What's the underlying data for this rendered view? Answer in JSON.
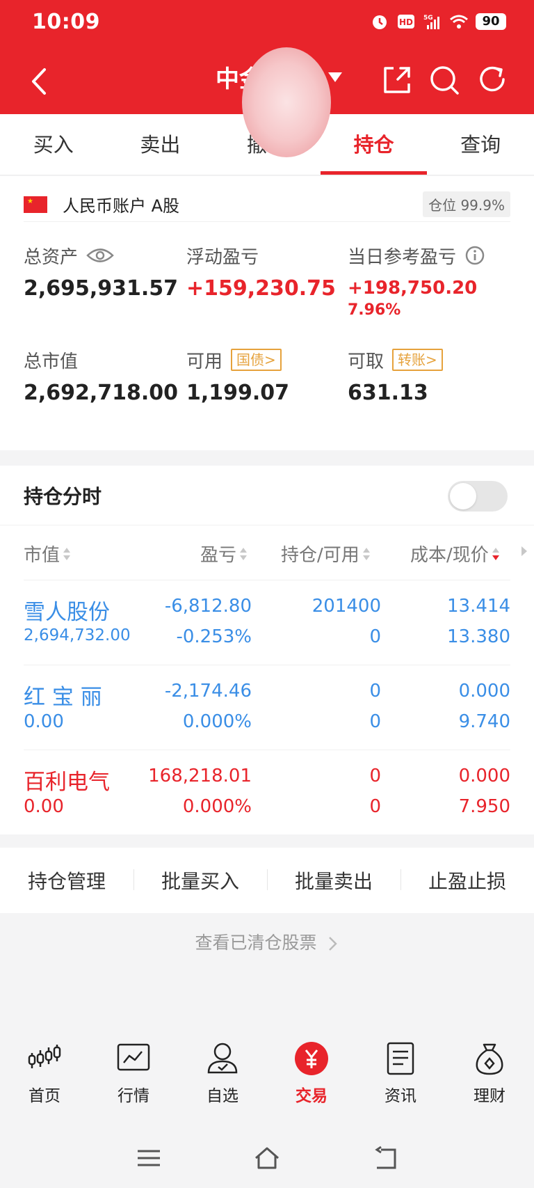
{
  "status_bar": {
    "time": "10:09",
    "battery": "90"
  },
  "header": {
    "title": "中金",
    "colors": {
      "brand": "#e8242b",
      "profit": "#e8242b",
      "loss_blue": "#3a8ee6",
      "tag_orange": "#e6a23c"
    }
  },
  "tabs": [
    {
      "label": "买入"
    },
    {
      "label": "卖出"
    },
    {
      "label": "撤单"
    },
    {
      "label": "持仓",
      "active": true
    },
    {
      "label": "查询"
    }
  ],
  "account": {
    "name": "人民币账户 A股",
    "position_label": "仓位 99.9%",
    "total_assets": {
      "label": "总资产",
      "value": "2,695,931.57"
    },
    "floating_pnl": {
      "label": "浮动盈亏",
      "value": "+159,230.75"
    },
    "daily_pnl": {
      "label": "当日参考盈亏",
      "value": "+198,750.20",
      "pct": "7.96%"
    },
    "market_value": {
      "label": "总市值",
      "value": "2,692,718.00"
    },
    "available": {
      "label": "可用",
      "tag": "国债>",
      "value": "1,199.07"
    },
    "withdrawable": {
      "label": "可取",
      "tag": "转账>",
      "value": "631.13"
    }
  },
  "holdings": {
    "title": "持仓分时",
    "toggle_on": false,
    "columns": [
      "市值",
      "盈亏",
      "持仓/可用",
      "成本/现价"
    ],
    "rows": [
      {
        "name": "雪人股份",
        "market_value": "2,694,732.00",
        "pnl": "-6,812.80",
        "pnl_pct": "-0.253%",
        "position": "201400",
        "available": "0",
        "cost": "13.414",
        "price": "13.380",
        "color": "blue"
      },
      {
        "name": "红 宝 丽",
        "market_value": "0.00",
        "pnl": "-2,174.46",
        "pnl_pct": "0.000%",
        "position": "0",
        "available": "0",
        "cost": "0.000",
        "price": "9.740",
        "color": "blue"
      },
      {
        "name": "百利电气",
        "market_value": "0.00",
        "pnl": "168,218.01",
        "pnl_pct": "0.000%",
        "position": "0",
        "available": "0",
        "cost": "0.000",
        "price": "7.950",
        "color": "red"
      }
    ]
  },
  "actions": [
    "持仓管理",
    "批量买入",
    "批量卖出",
    "止盈止损"
  ],
  "cleared_link": "查看已清仓股票",
  "bottom_nav": [
    {
      "label": "首页",
      "icon": "candlestick-icon"
    },
    {
      "label": "行情",
      "icon": "chart-icon"
    },
    {
      "label": "自选",
      "icon": "user-check-icon"
    },
    {
      "label": "交易",
      "icon": "yuan-icon",
      "active": true
    },
    {
      "label": "资讯",
      "icon": "document-icon"
    },
    {
      "label": "理财",
      "icon": "money-bag-icon"
    }
  ]
}
